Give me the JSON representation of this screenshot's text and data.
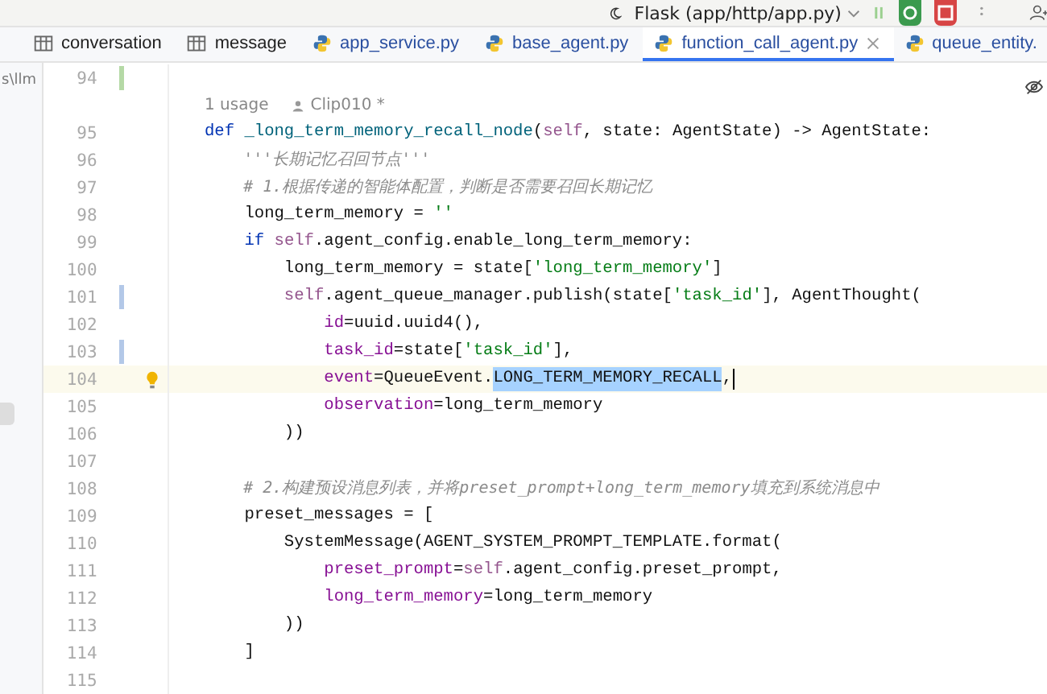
{
  "toolbar": {
    "run_config": "Flask (app/http/app.py)"
  },
  "tabs": [
    {
      "label": "conversation",
      "kind": "table",
      "selected": false
    },
    {
      "label": "message",
      "kind": "table",
      "selected": false
    },
    {
      "label": "app_service.py",
      "kind": "python",
      "selected": false
    },
    {
      "label": "base_agent.py",
      "kind": "python",
      "selected": false
    },
    {
      "label": "function_call_agent.py",
      "kind": "python",
      "selected": true
    },
    {
      "label": "queue_entity.",
      "kind": "python",
      "selected": false
    }
  ],
  "project_path": "s\\llm",
  "lines": [
    {
      "kind": "code",
      "number": "94",
      "added": true,
      "modified": false,
      "current": false,
      "bulb": false
    },
    {
      "kind": "inlay",
      "usages": "1 usage",
      "author": "Clip010 *"
    },
    {
      "kind": "code",
      "number": "95",
      "added": false,
      "modified": false,
      "current": false,
      "bulb": false,
      "tokens": [
        {
          "t": "def ",
          "kind": "keyword"
        },
        {
          "t": "_long_term_memory_recall_node",
          "kind": "func"
        },
        {
          "t": "(",
          "kind": "plain"
        },
        {
          "t": "self",
          "kind": "self"
        },
        {
          "t": ", state: AgentState) -> AgentState:",
          "kind": "plain"
        }
      ]
    },
    {
      "kind": "code",
      "number": "96",
      "added": false,
      "modified": false,
      "current": false,
      "bulb": false,
      "tokens": [
        {
          "t": "    '''长期记忆召回节点'''",
          "kind": "docstring"
        }
      ]
    },
    {
      "kind": "code",
      "number": "97",
      "added": false,
      "modified": false,
      "current": false,
      "bulb": false,
      "tokens": [
        {
          "t": "    # 1.根据传递的智能体配置，判断是否需要召回长期记忆",
          "kind": "comment"
        }
      ]
    },
    {
      "kind": "code",
      "number": "98",
      "added": false,
      "modified": false,
      "current": false,
      "bulb": false,
      "tokens": [
        {
          "t": "    long_term_memory = ",
          "kind": "plain"
        },
        {
          "t": "''",
          "kind": "string"
        }
      ]
    },
    {
      "kind": "code",
      "number": "99",
      "added": false,
      "modified": false,
      "current": false,
      "bulb": false,
      "tokens": [
        {
          "t": "    if ",
          "kind": "keyword"
        },
        {
          "t": "self",
          "kind": "self"
        },
        {
          "t": ".agent_config.enable_long_term_memory:",
          "kind": "plain"
        }
      ]
    },
    {
      "kind": "code",
      "number": "100",
      "added": false,
      "modified": false,
      "current": false,
      "bulb": false,
      "tokens": [
        {
          "t": "        long_term_memory = state[",
          "kind": "plain"
        },
        {
          "t": "'long_term_memory'",
          "kind": "string"
        },
        {
          "t": "]",
          "kind": "plain"
        }
      ]
    },
    {
      "kind": "code",
      "number": "101",
      "added": false,
      "modified": true,
      "current": false,
      "bulb": false,
      "tokens": [
        {
          "t": "        self",
          "kind": "self"
        },
        {
          "t": ".agent_queue_manager.publish(state[",
          "kind": "plain"
        },
        {
          "t": "'task_id'",
          "kind": "string"
        },
        {
          "t": "], AgentThought(",
          "kind": "plain"
        }
      ]
    },
    {
      "kind": "code",
      "number": "102",
      "added": false,
      "modified": false,
      "current": false,
      "bulb": false,
      "tokens": [
        {
          "t": "            id",
          "kind": "param"
        },
        {
          "t": "=uuid.uuid4(),",
          "kind": "plain"
        }
      ]
    },
    {
      "kind": "code",
      "number": "103",
      "added": false,
      "modified": true,
      "current": false,
      "bulb": false,
      "tokens": [
        {
          "t": "            task_id",
          "kind": "param"
        },
        {
          "t": "=state[",
          "kind": "plain"
        },
        {
          "t": "'task_id'",
          "kind": "string"
        },
        {
          "t": "],",
          "kind": "plain"
        }
      ]
    },
    {
      "kind": "code",
      "number": "104",
      "added": false,
      "modified": false,
      "current": true,
      "bulb": true,
      "tokens": [
        {
          "t": "            event",
          "kind": "param"
        },
        {
          "t": "=QueueEvent.",
          "kind": "plain"
        },
        {
          "t": "LONG_TERM_MEMORY_RECALL",
          "kind": "selection"
        },
        {
          "t": ",",
          "kind": "plain"
        }
      ]
    },
    {
      "kind": "code",
      "number": "105",
      "added": false,
      "modified": false,
      "current": false,
      "bulb": false,
      "tokens": [
        {
          "t": "            observation",
          "kind": "param"
        },
        {
          "t": "=long_term_memory",
          "kind": "plain"
        }
      ]
    },
    {
      "kind": "code",
      "number": "106",
      "added": false,
      "modified": false,
      "current": false,
      "bulb": false,
      "tokens": [
        {
          "t": "        ))",
          "kind": "plain"
        }
      ]
    },
    {
      "kind": "code",
      "number": "107",
      "added": false,
      "modified": false,
      "current": false,
      "bulb": false
    },
    {
      "kind": "code",
      "number": "108",
      "added": false,
      "modified": false,
      "current": false,
      "bulb": false,
      "tokens": [
        {
          "t": "    # 2.构建预设消息列表，并将preset_prompt+long_term_memory填充到系统消息中",
          "kind": "comment"
        }
      ]
    },
    {
      "kind": "code",
      "number": "109",
      "added": false,
      "modified": false,
      "current": false,
      "bulb": false,
      "tokens": [
        {
          "t": "    preset_messages = [",
          "kind": "plain"
        }
      ]
    },
    {
      "kind": "code",
      "number": "110",
      "added": false,
      "modified": false,
      "current": false,
      "bulb": false,
      "tokens": [
        {
          "t": "        SystemMessage(AGENT_SYSTEM_PROMPT_TEMPLATE.format(",
          "kind": "plain"
        }
      ]
    },
    {
      "kind": "code",
      "number": "111",
      "added": false,
      "modified": false,
      "current": false,
      "bulb": false,
      "tokens": [
        {
          "t": "            preset_prompt",
          "kind": "param"
        },
        {
          "t": "=",
          "kind": "plain"
        },
        {
          "t": "self",
          "kind": "self"
        },
        {
          "t": ".agent_config.preset_prompt,",
          "kind": "plain"
        }
      ]
    },
    {
      "kind": "code",
      "number": "112",
      "added": false,
      "modified": false,
      "current": false,
      "bulb": false,
      "tokens": [
        {
          "t": "            long_term_memory",
          "kind": "param"
        },
        {
          "t": "=long_term_memory",
          "kind": "plain"
        }
      ]
    },
    {
      "kind": "code",
      "number": "113",
      "added": false,
      "modified": false,
      "current": false,
      "bulb": false,
      "tokens": [
        {
          "t": "        ))",
          "kind": "plain"
        }
      ]
    },
    {
      "kind": "code",
      "number": "114",
      "added": false,
      "modified": false,
      "current": false,
      "bulb": false,
      "tokens": [
        {
          "t": "    ]",
          "kind": "plain"
        }
      ]
    },
    {
      "kind": "code",
      "number": "115",
      "added": false,
      "modified": false,
      "current": false,
      "bulb": false
    }
  ]
}
